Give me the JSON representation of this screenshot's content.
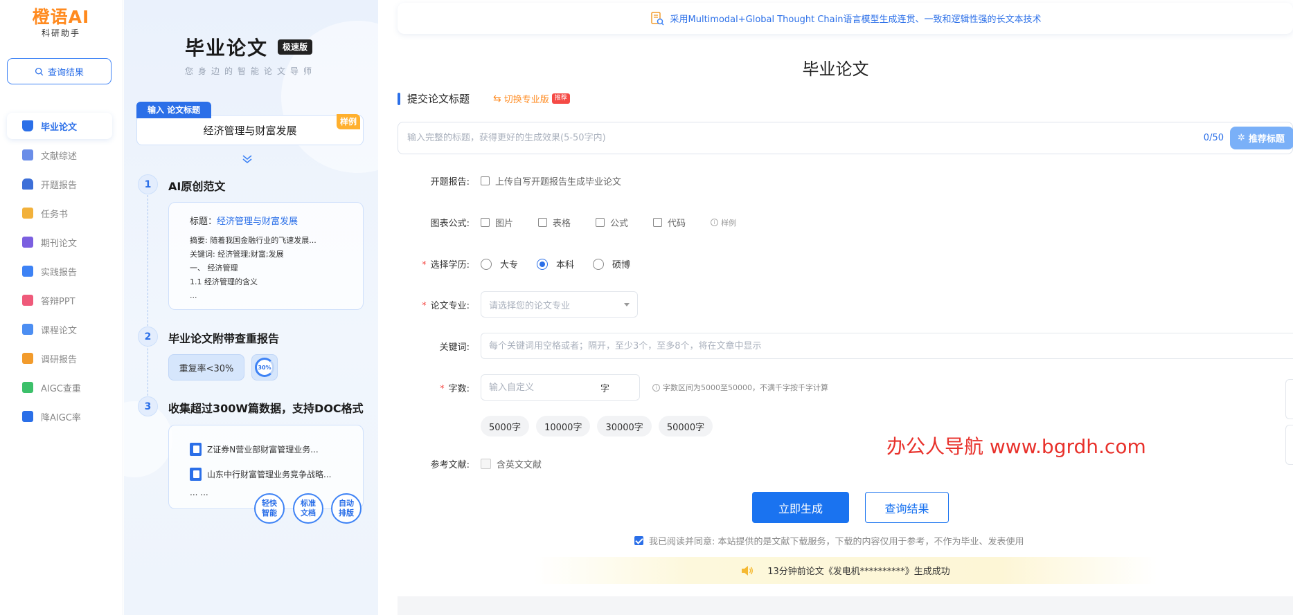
{
  "brand": {
    "name": "橙语AI",
    "subtitle": "科研助手"
  },
  "nav": {
    "query_button": "查询结果",
    "items": [
      {
        "label": "毕业论文",
        "icon": "graduation-cap-icon",
        "active": true
      },
      {
        "label": "文献综述",
        "icon": "document-icon"
      },
      {
        "label": "开题报告",
        "icon": "stamp-icon"
      },
      {
        "label": "任务书",
        "icon": "task-book-icon"
      },
      {
        "label": "期刊论文",
        "icon": "journal-icon"
      },
      {
        "label": "实践报告",
        "icon": "edit-report-icon"
      },
      {
        "label": "答辩PPT",
        "icon": "ppt-icon"
      },
      {
        "label": "课程论文",
        "icon": "course-doc-icon"
      },
      {
        "label": "调研报告",
        "icon": "survey-icon"
      },
      {
        "label": "AIGC查重",
        "icon": "aigc-check-icon"
      },
      {
        "label": "降AIGC率",
        "icon": "chart-down-icon"
      }
    ]
  },
  "promo": {
    "title": "毕业论文",
    "badge": "极速版",
    "slogan": "您身边的智能论文导师",
    "input_tag": "输入 论文标题",
    "input_value": "经济管理与财富发展",
    "sample_tag": "样例",
    "steps": [
      {
        "num": "1",
        "title": "AI原创范文"
      },
      {
        "num": "2",
        "title": "毕业论文附带查重报告"
      },
      {
        "num": "3",
        "title": "收集超过300W篇数据，支持DOC格式"
      }
    ],
    "card1": {
      "title_label": "标题：",
      "title_value": "经济管理与财富发展",
      "lines": [
        "摘要: 随着我国金融行业的飞速发展...",
        "关键词: 经济管理;财富;发展",
        "一、 经济管理",
        "1.1 经济管理的含义",
        "..."
      ]
    },
    "dup_rate": "重复率<30%",
    "ring_label": "30%",
    "docs": [
      "Z证券N营业部财富管理业务...",
      "山东中行财富管理业务竞争战略..."
    ],
    "docs_more": "... ...",
    "features": [
      "轻快智能",
      "标准文档",
      "自动排版"
    ]
  },
  "main": {
    "banner": "采用Multimodal+Global Thought Chain语言模型生成连贯、一致和逻辑性强的长文本技术",
    "page_title": "毕业论文",
    "section_label": "提交论文标题",
    "switch_label": "切换专业版",
    "switch_badge": "推荐",
    "title_placeholder": "输入完整的标题，获得更好的生成效果(5-50字内)",
    "char_count": "0/50",
    "recommend_button": "推荐标题",
    "form": {
      "proposal_label": "开题报告:",
      "proposal_option": "上传自写开题报告生成毕业论文",
      "charts_label": "图表公式:",
      "charts_options": [
        "图片",
        "表格",
        "公式",
        "代码"
      ],
      "charts_sample": "样例",
      "degree_label": "选择学历:",
      "degree_options": [
        {
          "label": "大专",
          "selected": false
        },
        {
          "label": "本科",
          "selected": true
        },
        {
          "label": "硕博",
          "selected": false
        }
      ],
      "major_label": "论文专业:",
      "major_placeholder": "请选择您的论文专业",
      "keywords_label": "关键词:",
      "keywords_placeholder": "每个关键词用空格或者；隔开，至少3个，至多8个，将在文章中显示",
      "wordcount_label": "字数:",
      "wordcount_placeholder": "输入自定义",
      "wordcount_unit": "字",
      "wordcount_hint": "字数区间为5000至50000，不满千字按千字计算",
      "wordcount_presets": [
        "5000字",
        "10000字",
        "30000字",
        "50000字"
      ],
      "refs_label": "参考文献:",
      "refs_option": "含英文文献"
    },
    "watermark": "办公人导航 www.bgrdh.com",
    "generate_button": "立即生成",
    "query_button": "查询结果",
    "agreement": "我已阅读并同意: 本站提供的是文献下载服务，下载的内容仅用于参考，不作为毕业、发表使用",
    "agreement_checked": true,
    "notice": "13分钟前论文《发电机**********》生成成功"
  }
}
